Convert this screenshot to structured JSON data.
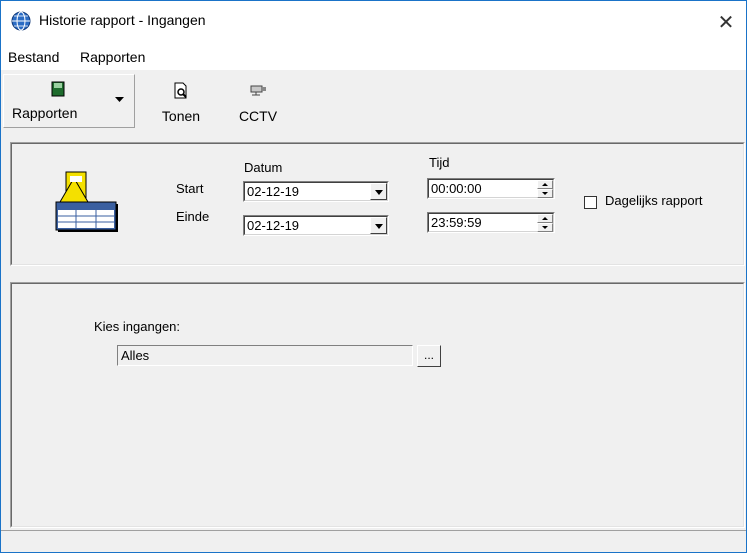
{
  "window": {
    "title": "Historie rapport - Ingangen",
    "close_symbol": "✕"
  },
  "menu": {
    "items": [
      "Bestand",
      "Rapporten"
    ]
  },
  "toolbar": {
    "rapporten_label": "Rapporten",
    "tonen_label": "Tonen",
    "cctv_label": "CCTV"
  },
  "range": {
    "datum_header": "Datum",
    "tijd_header": "Tijd",
    "start_label": "Start",
    "einde_label": "Einde",
    "start_date": "02-12-19",
    "end_date": "02-12-19",
    "start_time": "00:00:00",
    "end_time": "23:59:59",
    "daily_label": "Dagelijks rapport",
    "daily_checked": false
  },
  "inputs": {
    "label": "Kies ingangen:",
    "value": "Alles",
    "browse_label": "..."
  },
  "colors": {
    "accent": "#1a73c8",
    "icon_yellow": "#f4e000",
    "icon_blue": "#3a5fa0"
  }
}
